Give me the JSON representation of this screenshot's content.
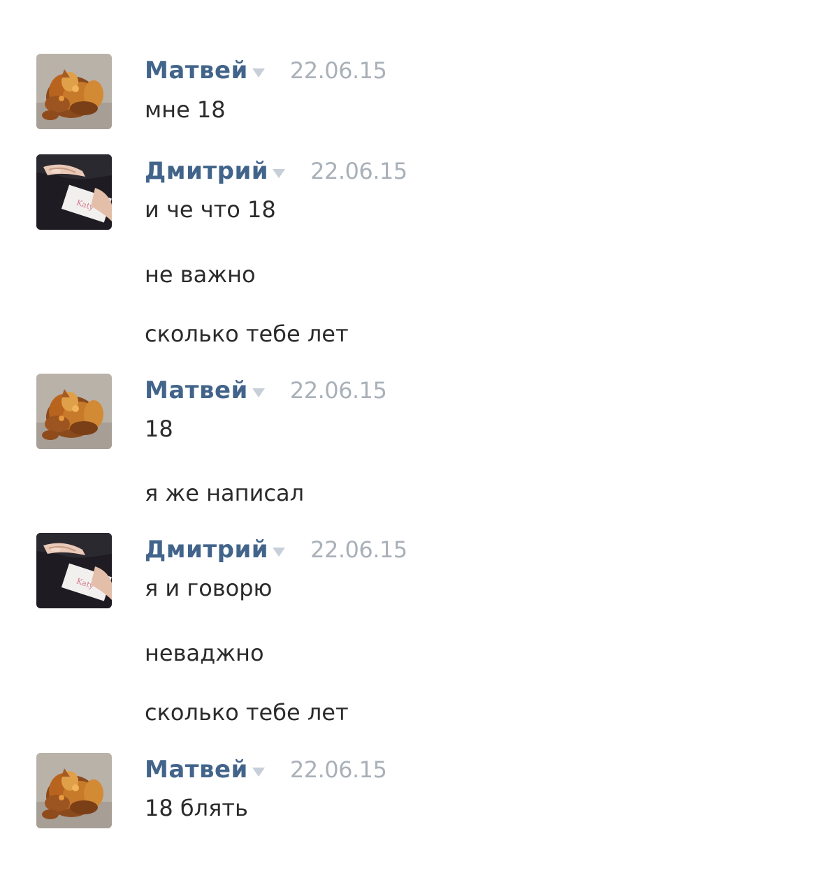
{
  "messages": [
    {
      "author": "Матвей",
      "date": "22.06.15",
      "avatar": "autumn-leaves-avatar-icon",
      "lines": [
        "мне 18"
      ]
    },
    {
      "author": "Дмитрий",
      "date": "22.06.15",
      "avatar": "hand-with-card-avatar-icon",
      "lines": [
        "и че что 18",
        "не важно",
        "сколько тебе лет"
      ]
    },
    {
      "author": "Матвей",
      "date": "22.06.15",
      "avatar": "autumn-leaves-avatar-icon",
      "lines": [
        "18",
        "я же написал"
      ]
    },
    {
      "author": "Дмитрий",
      "date": "22.06.15",
      "avatar": "hand-with-card-avatar-icon",
      "lines": [
        "я и говорю",
        "неваджно",
        "сколько тебе лет"
      ]
    },
    {
      "author": "Матвей",
      "date": "22.06.15",
      "avatar": "autumn-leaves-avatar-icon",
      "lines": [
        "18 блять"
      ]
    }
  ],
  "colors": {
    "author": "#42648b",
    "date": "#a9b0b8",
    "text": "#2b2b2b",
    "background": "#ffffff"
  }
}
